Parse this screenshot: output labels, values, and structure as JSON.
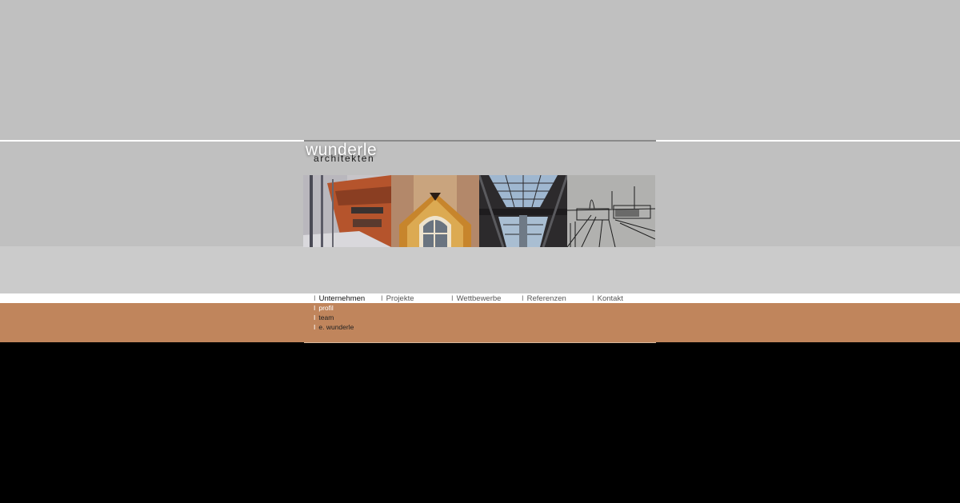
{
  "brand": {
    "name": "wunderle",
    "tagline": "architekten"
  },
  "nav": {
    "items": [
      "Unternehmen",
      "Projekte",
      "Wettbewerbe",
      "Referenzen",
      "Kontakt"
    ],
    "separator": "I"
  },
  "subnav": {
    "items": [
      "profil",
      "team",
      "e. wunderle"
    ]
  },
  "photos": [
    "brick-facade-photo",
    "ornate-doorway-photo",
    "glass-roof-photo",
    "architectural-sketch-photo"
  ],
  "colors": {
    "grey": "#c0c0c0",
    "accent": "#c0855c",
    "background": "#000000"
  }
}
